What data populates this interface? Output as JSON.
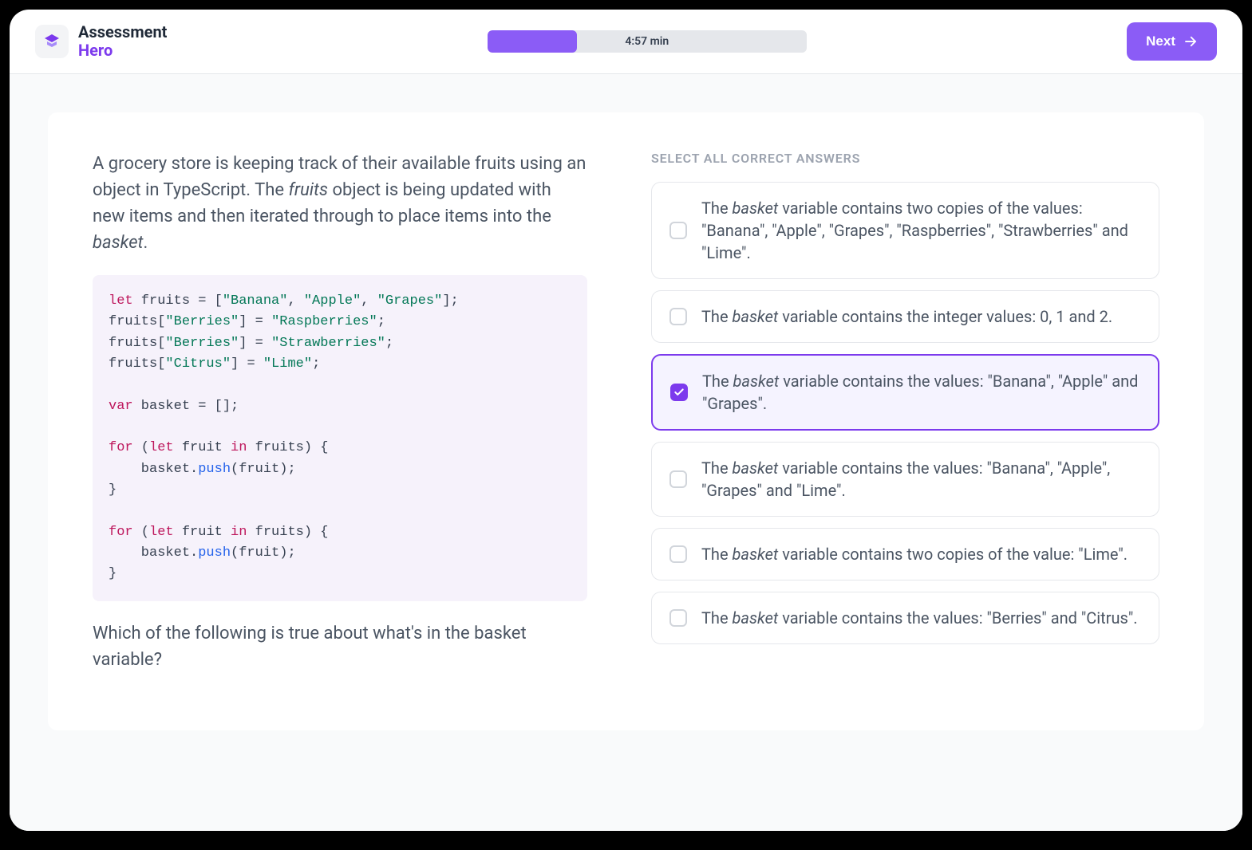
{
  "header": {
    "logo_line1": "Assessment",
    "logo_line2": "Hero",
    "timer_label": "4:57 min",
    "progress_percent": 28,
    "next_label": "Next"
  },
  "question": {
    "intro_pre": "A grocery store is keeping track of their available fruits using an object in TypeScript. The ",
    "intro_em1": "fruits",
    "intro_mid": " object is being updated with new items and then iterated through to place items into the ",
    "intro_em2": "basket",
    "intro_post": ".",
    "code": {
      "line1_kw": "let",
      "line1_rest_a": " fruits = [",
      "line1_str1": "\"Banana\"",
      "line1_sep1": ", ",
      "line1_str2": "\"Apple\"",
      "line1_sep2": ", ",
      "line1_str3": "\"Grapes\"",
      "line1_rest_b": "];",
      "line2_a": "fruits[",
      "line2_str1": "\"Berries\"",
      "line2_b": "] = ",
      "line2_str2": "\"Raspberries\"",
      "line2_c": ";",
      "line3_a": "fruits[",
      "line3_str1": "\"Berries\"",
      "line3_b": "] = ",
      "line3_str2": "\"Strawberries\"",
      "line3_c": ";",
      "line4_a": "fruits[",
      "line4_str1": "\"Citrus\"",
      "line4_b": "] = ",
      "line4_str2": "\"Lime\"",
      "line4_c": ";",
      "line5_kw": "var",
      "line5_rest": " basket = [];",
      "line6_kw1": "for",
      "line6_a": " (",
      "line6_kw2": "let",
      "line6_b": " fruit ",
      "line6_kw3": "in",
      "line6_c": " fruits) {",
      "line7_a": "    basket.",
      "line7_fn": "push",
      "line7_b": "(fruit);",
      "line8": "}",
      "line9_kw1": "for",
      "line9_a": " (",
      "line9_kw2": "let",
      "line9_b": " fruit ",
      "line9_kw3": "in",
      "line9_c": " fruits) {",
      "line10_a": "    basket.",
      "line10_fn": "push",
      "line10_b": "(fruit);",
      "line11": "}"
    },
    "followup": "Which of the following is true about what's in the basket variable?"
  },
  "answers": {
    "header": "SELECT ALL CORRECT ANSWERS",
    "options": [
      {
        "pre": "The ",
        "em": "basket",
        "post": " variable contains two copies of the values: \"Banana\", \"Apple\", \"Grapes\", \"Raspberries\", \"Strawberries\" and \"Lime\".",
        "selected": false
      },
      {
        "pre": "The ",
        "em": "basket",
        "post": " variable contains the integer values: 0, 1 and 2.",
        "selected": false
      },
      {
        "pre": "The ",
        "em": "basket",
        "post": " variable contains the values: \"Banana\", \"Apple\" and \"Grapes\".",
        "selected": true
      },
      {
        "pre": "The ",
        "em": "basket",
        "post": " variable contains the values: \"Banana\", \"Apple\", \"Grapes\" and \"Lime\".",
        "selected": false
      },
      {
        "pre": "The ",
        "em": "basket",
        "post": " variable contains two copies of the value: \"Lime\".",
        "selected": false
      },
      {
        "pre": "The ",
        "em": "basket",
        "post": " variable contains the values: \"Berries\" and \"Citrus\".",
        "selected": false
      }
    ]
  }
}
